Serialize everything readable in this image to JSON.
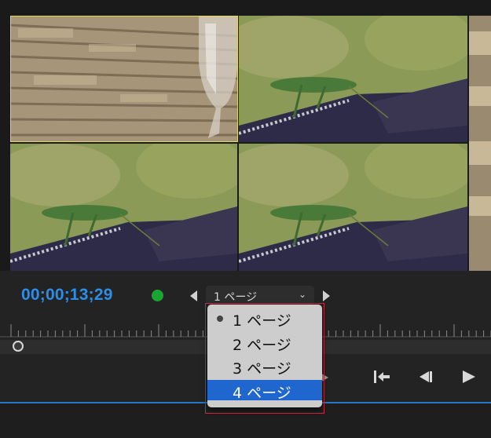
{
  "monitor": {
    "timecode": "00;00;13;29",
    "status_color": "#1aa532",
    "timecode_color": "#2b8ee8",
    "page_select_value": "1 ページ",
    "thumbnails": [
      {
        "subject": "glass-on-brick-wall",
        "selected": true
      },
      {
        "subject": "grasshopper"
      },
      {
        "subject": "grasshopper"
      },
      {
        "subject": "grasshopper"
      },
      {
        "subject": "partial-clip"
      }
    ]
  },
  "dropdown": {
    "items": [
      {
        "label": "1 ページ",
        "checked": true,
        "highlighted": false
      },
      {
        "label": "2 ページ",
        "checked": false,
        "highlighted": false
      },
      {
        "label": "3 ページ",
        "checked": false,
        "highlighted": false
      },
      {
        "label": "4 ページ",
        "checked": false,
        "highlighted": true
      }
    ],
    "highlight_color": "#1f66cf",
    "outline_color": "#d8283b"
  },
  "transport": {
    "icons": [
      "go-to-in-icon",
      "step-back-icon",
      "play-icon"
    ]
  },
  "accent_line_color": "#2677c9"
}
